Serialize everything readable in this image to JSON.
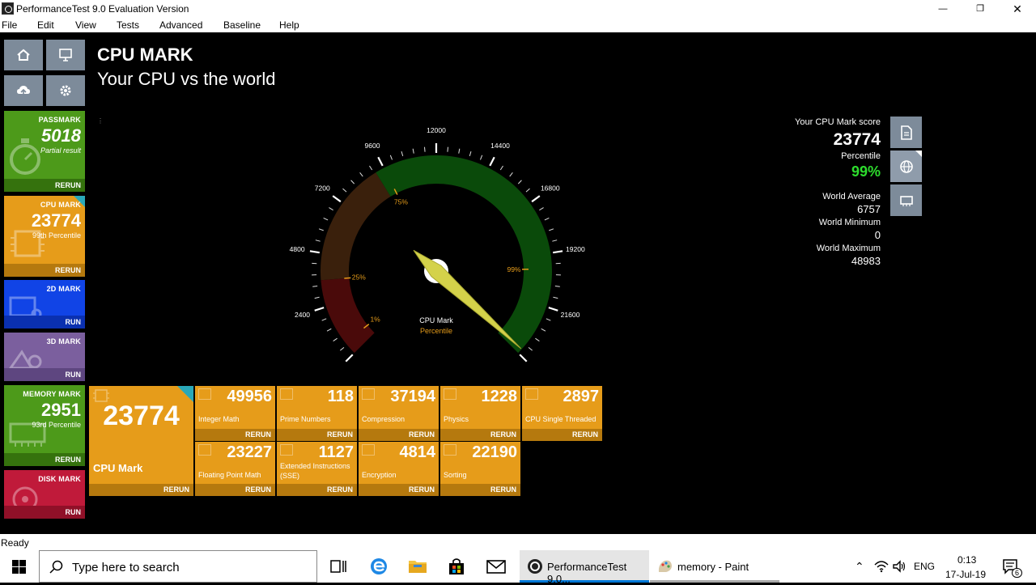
{
  "window": {
    "title": "PerformanceTest 9.0 Evaluation Version"
  },
  "menu": [
    "File",
    "Edit",
    "View",
    "Tests",
    "Advanced",
    "Baseline",
    "Help"
  ],
  "heading": {
    "title": "CPU MARK",
    "subtitle": "Your CPU vs the world"
  },
  "sidebar": {
    "passmark": {
      "name": "PASSMARK",
      "score": "5018",
      "sub": "Partial result",
      "action": "RERUN",
      "color": "#4d9a1a"
    },
    "cpu": {
      "name": "CPU MARK",
      "score": "23774",
      "sub": "99th Percentile",
      "action": "RERUN",
      "color": "#e69c1a"
    },
    "g2d": {
      "name": "2D MARK",
      "action": "RUN",
      "color": "#1144e6"
    },
    "g3d": {
      "name": "3D MARK",
      "action": "RUN",
      "color": "#7b5f9e"
    },
    "memory": {
      "name": "MEMORY MARK",
      "score": "2951",
      "sub": "93rd Percentile",
      "action": "RERUN",
      "color": "#4d9a1a"
    },
    "disk": {
      "name": "DISK MARK",
      "action": "RUN",
      "color": "#c01a3a"
    }
  },
  "gauge": {
    "ticks": [
      "0",
      "2400",
      "4800",
      "7200",
      "9600",
      "12000",
      "14400",
      "16800",
      "19200",
      "21600",
      "24000"
    ],
    "max": 24000,
    "value": 23774,
    "percentiles": [
      {
        "label": "1%",
        "value": 600
      },
      {
        "label": "25%",
        "value": 3600
      },
      {
        "label": "75%",
        "value": 9600
      },
      {
        "label": "99%",
        "value": 19900
      }
    ],
    "zones": [
      {
        "from": 0,
        "to": 3600,
        "color": "#4a0a0a"
      },
      {
        "from": 3600,
        "to": 9200,
        "color": "#3a200c"
      },
      {
        "from": 9200,
        "to": 24000,
        "color": "#0a4a0a"
      }
    ],
    "legend_main": "CPU Mark",
    "legend_sub": "Percentile"
  },
  "results": {
    "score_label": "Your CPU Mark score",
    "score": "23774",
    "percentile_label": "Percentile",
    "percentile": "99%",
    "avg_label": "World Average",
    "avg": "6757",
    "min_label": "World Minimum",
    "min": "0",
    "max_label": "World Maximum",
    "max": "48983"
  },
  "big_tile": {
    "score": "23774",
    "label": "CPU Mark",
    "action": "RERUN"
  },
  "subtests": [
    {
      "value": "49956",
      "label": "Integer Math",
      "action": "RERUN"
    },
    {
      "value": "118",
      "label": "Prime Numbers",
      "action": "RERUN"
    },
    {
      "value": "37194",
      "label": "Compression",
      "action": "RERUN"
    },
    {
      "value": "1228",
      "label": "Physics",
      "action": "RERUN"
    },
    {
      "value": "2897",
      "label": "CPU Single Threaded",
      "action": "RERUN"
    },
    {
      "value": "23227",
      "label": "Floating Point Math",
      "action": "RERUN"
    },
    {
      "value": "1127",
      "label": "Extended Instructions (SSE)",
      "action": "RERUN"
    },
    {
      "value": "4814",
      "label": "Encryption",
      "action": "RERUN"
    },
    {
      "value": "22190",
      "label": "Sorting",
      "action": "RERUN"
    }
  ],
  "status": "Ready",
  "taskbar": {
    "search_placeholder": "Type here to search",
    "apps": [
      "PerformanceTest 9.0...",
      "memory - Paint"
    ],
    "lang": "ENG",
    "time": "0:13",
    "date": "17-Jul-19",
    "notifications": "6"
  }
}
